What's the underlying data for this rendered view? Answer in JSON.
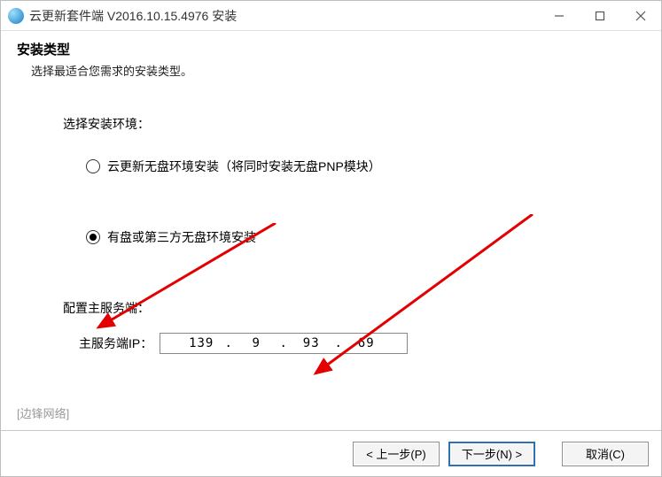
{
  "window": {
    "title": "云更新套件端 V2016.10.15.4976 安装"
  },
  "header": {
    "title": "安装类型",
    "subtitle": "选择最适合您需求的安装类型。"
  },
  "install_env": {
    "label": "选择安装环境：",
    "option1": "云更新无盘环境安装（将同时安装无盘PNP模块）",
    "option2": "有盘或第三方无盘环境安装"
  },
  "server": {
    "label": "配置主服务端：",
    "ip_label": "主服务端IP：",
    "ip": {
      "o1": "139",
      "o2": "9",
      "o3": "93",
      "o4": "69"
    }
  },
  "brand": "[边锋网络]",
  "buttons": {
    "prev": "< 上一步(P)",
    "next": "下一步(N) >",
    "cancel": "取消(C)"
  }
}
